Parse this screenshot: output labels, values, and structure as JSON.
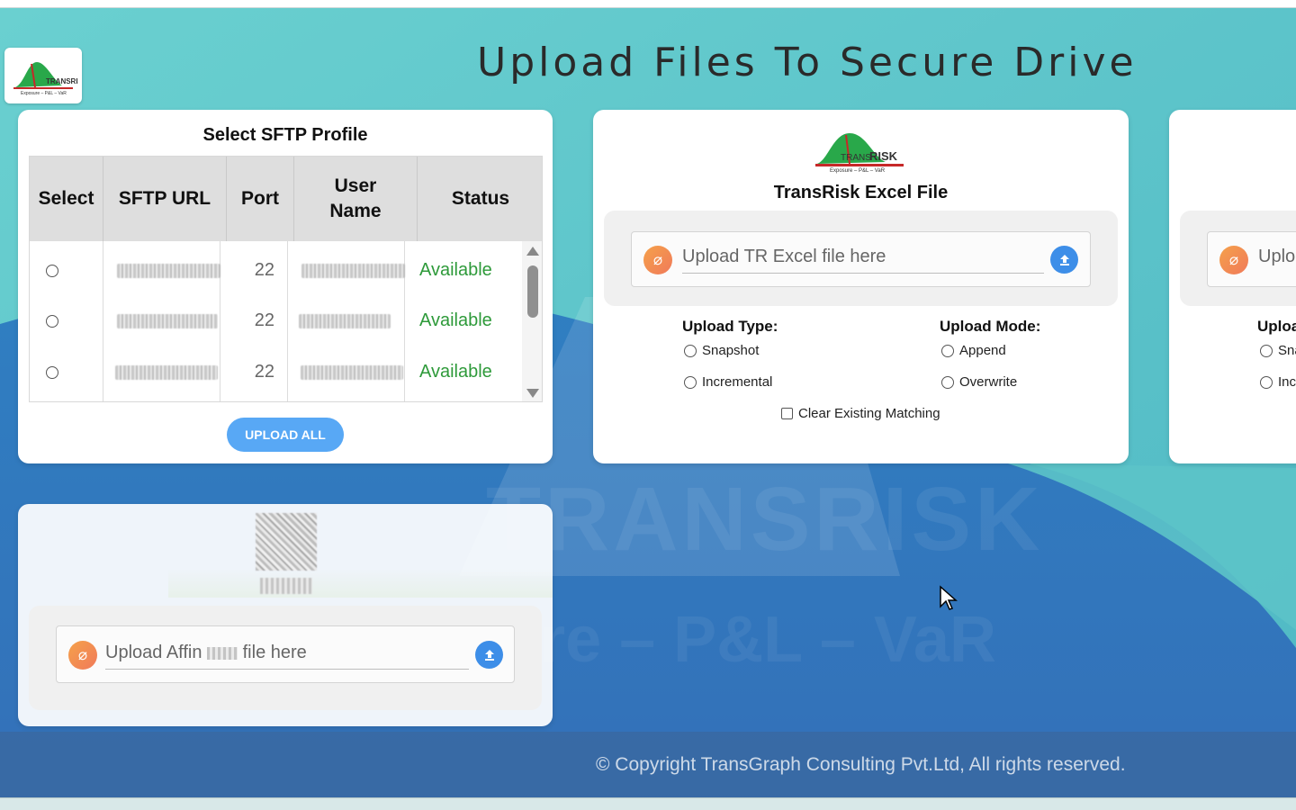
{
  "page": {
    "title": "Upload Files To Secure Drive"
  },
  "logo": {
    "brand": "TRANSRISK",
    "tagline": "Exposure – P&L – VaR"
  },
  "sftp": {
    "title": "Select SFTP Profile",
    "columns": [
      "Select",
      "SFTP URL",
      "Port",
      "User Name",
      "Status"
    ],
    "rows": [
      {
        "port": "22",
        "status": "Available"
      },
      {
        "port": "22",
        "status": "Available"
      },
      {
        "port": "22",
        "status": "Available"
      }
    ],
    "upload_all": "UPLOAD ALL"
  },
  "tr_card": {
    "title": "TransRisk Excel File",
    "placeholder": "Upload TR Excel file here",
    "upload_type_label": "Upload Type:",
    "upload_type_options": [
      "Snapshot",
      "Incremental"
    ],
    "upload_mode_label": "Upload Mode:",
    "upload_mode_options": [
      "Append",
      "Overwrite"
    ],
    "clear_label": "Clear Existing Matching"
  },
  "third_card": {
    "placeholder_partial": "Uplo",
    "label_partial": "Uploa",
    "opt1_partial": "Sna",
    "opt2_partial": "Inc"
  },
  "affin": {
    "placeholder_prefix": "Upload Affin",
    "placeholder_suffix": "file here"
  },
  "watermark": {
    "line1": "TRANSRISK",
    "line2": "Exposure – P&L – VaR"
  },
  "footer": {
    "copyright": "© Copyright TransGraph Consulting Pvt.Ltd, All rights reserved."
  },
  "colors": {
    "accent": "#58a8f5",
    "status_available": "#2e9a3a",
    "upload_icon": "#3d8ee8"
  }
}
